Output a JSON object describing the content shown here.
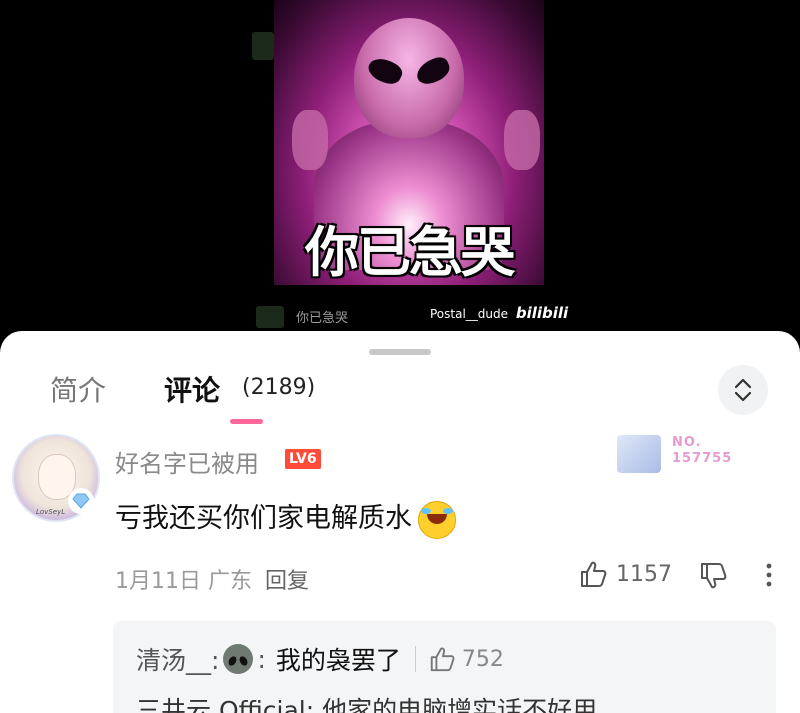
{
  "video": {
    "meme_caption": "你已急哭",
    "under_caption": "你已急哭",
    "watermark_user": "Postal__dude",
    "watermark_brand": "bilibili"
  },
  "tabs": {
    "intro_label": "简介",
    "comments_label": "评论",
    "comments_count": "(2189)",
    "indicator_color": "#ff6699"
  },
  "sort_button": {
    "icon": "sort-updown-icon"
  },
  "comment": {
    "username": "好名字已被用",
    "level": "LV6",
    "level_color": "#ff4b3a",
    "avatar_signature": "LovSeyL",
    "fan_badge_number": "NO.\n157755",
    "text": "亏我还买你们家电解质水",
    "emoji": "crying-laughing-emoji",
    "date": "1月11日",
    "location": "广东",
    "reply_label": "回复",
    "likes": "1157"
  },
  "replies": [
    {
      "user": "清汤__:",
      "emoji": "alien-emoji",
      "sep": ":",
      "text": "我的袅罢了",
      "likes": "752"
    },
    {
      "text": "三井云 Official: 他家的电脑增实话不好用"
    }
  ]
}
